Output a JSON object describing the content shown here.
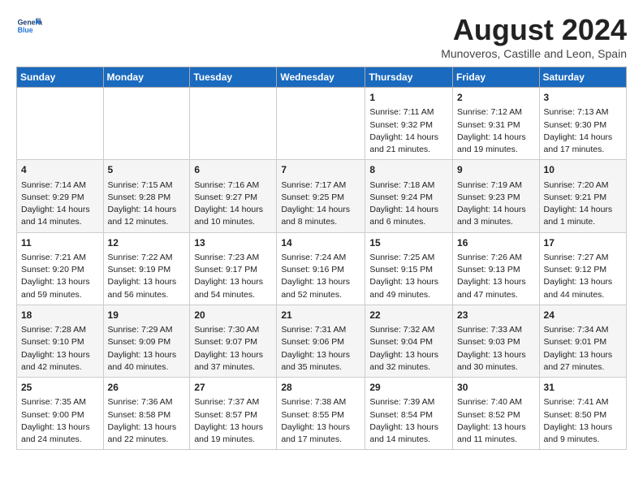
{
  "header": {
    "logo_line1": "General",
    "logo_line2": "Blue",
    "month": "August 2024",
    "location": "Munoveros, Castille and Leon, Spain"
  },
  "weekdays": [
    "Sunday",
    "Monday",
    "Tuesday",
    "Wednesday",
    "Thursday",
    "Friday",
    "Saturday"
  ],
  "weeks": [
    [
      {
        "day": "",
        "info": ""
      },
      {
        "day": "",
        "info": ""
      },
      {
        "day": "",
        "info": ""
      },
      {
        "day": "",
        "info": ""
      },
      {
        "day": "1",
        "info": "Sunrise: 7:11 AM\nSunset: 9:32 PM\nDaylight: 14 hours and 21 minutes."
      },
      {
        "day": "2",
        "info": "Sunrise: 7:12 AM\nSunset: 9:31 PM\nDaylight: 14 hours and 19 minutes."
      },
      {
        "day": "3",
        "info": "Sunrise: 7:13 AM\nSunset: 9:30 PM\nDaylight: 14 hours and 17 minutes."
      }
    ],
    [
      {
        "day": "4",
        "info": "Sunrise: 7:14 AM\nSunset: 9:29 PM\nDaylight: 14 hours and 14 minutes."
      },
      {
        "day": "5",
        "info": "Sunrise: 7:15 AM\nSunset: 9:28 PM\nDaylight: 14 hours and 12 minutes."
      },
      {
        "day": "6",
        "info": "Sunrise: 7:16 AM\nSunset: 9:27 PM\nDaylight: 14 hours and 10 minutes."
      },
      {
        "day": "7",
        "info": "Sunrise: 7:17 AM\nSunset: 9:25 PM\nDaylight: 14 hours and 8 minutes."
      },
      {
        "day": "8",
        "info": "Sunrise: 7:18 AM\nSunset: 9:24 PM\nDaylight: 14 hours and 6 minutes."
      },
      {
        "day": "9",
        "info": "Sunrise: 7:19 AM\nSunset: 9:23 PM\nDaylight: 14 hours and 3 minutes."
      },
      {
        "day": "10",
        "info": "Sunrise: 7:20 AM\nSunset: 9:21 PM\nDaylight: 14 hours and 1 minute."
      }
    ],
    [
      {
        "day": "11",
        "info": "Sunrise: 7:21 AM\nSunset: 9:20 PM\nDaylight: 13 hours and 59 minutes."
      },
      {
        "day": "12",
        "info": "Sunrise: 7:22 AM\nSunset: 9:19 PM\nDaylight: 13 hours and 56 minutes."
      },
      {
        "day": "13",
        "info": "Sunrise: 7:23 AM\nSunset: 9:17 PM\nDaylight: 13 hours and 54 minutes."
      },
      {
        "day": "14",
        "info": "Sunrise: 7:24 AM\nSunset: 9:16 PM\nDaylight: 13 hours and 52 minutes."
      },
      {
        "day": "15",
        "info": "Sunrise: 7:25 AM\nSunset: 9:15 PM\nDaylight: 13 hours and 49 minutes."
      },
      {
        "day": "16",
        "info": "Sunrise: 7:26 AM\nSunset: 9:13 PM\nDaylight: 13 hours and 47 minutes."
      },
      {
        "day": "17",
        "info": "Sunrise: 7:27 AM\nSunset: 9:12 PM\nDaylight: 13 hours and 44 minutes."
      }
    ],
    [
      {
        "day": "18",
        "info": "Sunrise: 7:28 AM\nSunset: 9:10 PM\nDaylight: 13 hours and 42 minutes."
      },
      {
        "day": "19",
        "info": "Sunrise: 7:29 AM\nSunset: 9:09 PM\nDaylight: 13 hours and 40 minutes."
      },
      {
        "day": "20",
        "info": "Sunrise: 7:30 AM\nSunset: 9:07 PM\nDaylight: 13 hours and 37 minutes."
      },
      {
        "day": "21",
        "info": "Sunrise: 7:31 AM\nSunset: 9:06 PM\nDaylight: 13 hours and 35 minutes."
      },
      {
        "day": "22",
        "info": "Sunrise: 7:32 AM\nSunset: 9:04 PM\nDaylight: 13 hours and 32 minutes."
      },
      {
        "day": "23",
        "info": "Sunrise: 7:33 AM\nSunset: 9:03 PM\nDaylight: 13 hours and 30 minutes."
      },
      {
        "day": "24",
        "info": "Sunrise: 7:34 AM\nSunset: 9:01 PM\nDaylight: 13 hours and 27 minutes."
      }
    ],
    [
      {
        "day": "25",
        "info": "Sunrise: 7:35 AM\nSunset: 9:00 PM\nDaylight: 13 hours and 24 minutes."
      },
      {
        "day": "26",
        "info": "Sunrise: 7:36 AM\nSunset: 8:58 PM\nDaylight: 13 hours and 22 minutes."
      },
      {
        "day": "27",
        "info": "Sunrise: 7:37 AM\nSunset: 8:57 PM\nDaylight: 13 hours and 19 minutes."
      },
      {
        "day": "28",
        "info": "Sunrise: 7:38 AM\nSunset: 8:55 PM\nDaylight: 13 hours and 17 minutes."
      },
      {
        "day": "29",
        "info": "Sunrise: 7:39 AM\nSunset: 8:54 PM\nDaylight: 13 hours and 14 minutes."
      },
      {
        "day": "30",
        "info": "Sunrise: 7:40 AM\nSunset: 8:52 PM\nDaylight: 13 hours and 11 minutes."
      },
      {
        "day": "31",
        "info": "Sunrise: 7:41 AM\nSunset: 8:50 PM\nDaylight: 13 hours and 9 minutes."
      }
    ]
  ]
}
